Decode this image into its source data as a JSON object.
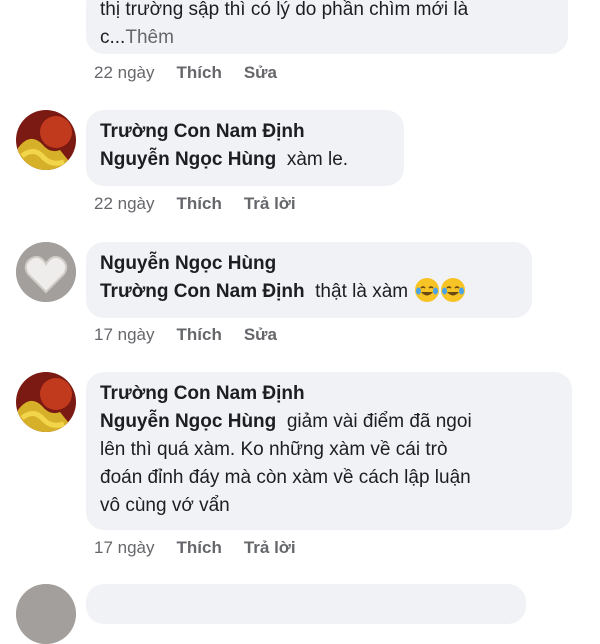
{
  "comments": [
    {
      "text_lines": [
        "thị trường sập thì có lý do phần chìm mới là",
        "c..."
      ],
      "more_label": "Thêm",
      "time": "22 ngày",
      "like": "Thích",
      "action": "Sửa"
    },
    {
      "author": "Trường Con Nam Định",
      "mention": "Nguyễn Ngọc Hùng",
      "text": "xàm le.",
      "time": "22 ngày",
      "like": "Thích",
      "action": "Trả lời"
    },
    {
      "author": "Nguyễn Ngọc Hùng",
      "mention": "Trường Con Nam Định",
      "text": "thật là xàm",
      "emoji": "laughing-tears-emoji",
      "time": "17 ngày",
      "like": "Thích",
      "action": "Sửa"
    },
    {
      "author": "Trường Con Nam Định",
      "mention": "Nguyễn Ngọc Hùng",
      "text_first": "giảm vài điểm đã ngoi",
      "text_lines": [
        "lên thì quá xàm. Ko những xàm về cái trò",
        "đoán đỉnh đáy mà còn xàm về cách lập luận",
        "vô cùng vớ vẩn"
      ],
      "time": "17 ngày",
      "like": "Thích",
      "action": "Trả lời"
    }
  ],
  "colors": {
    "bubble": "#f0f2f5",
    "meta": "#65676b",
    "text": "#1c1e21"
  }
}
